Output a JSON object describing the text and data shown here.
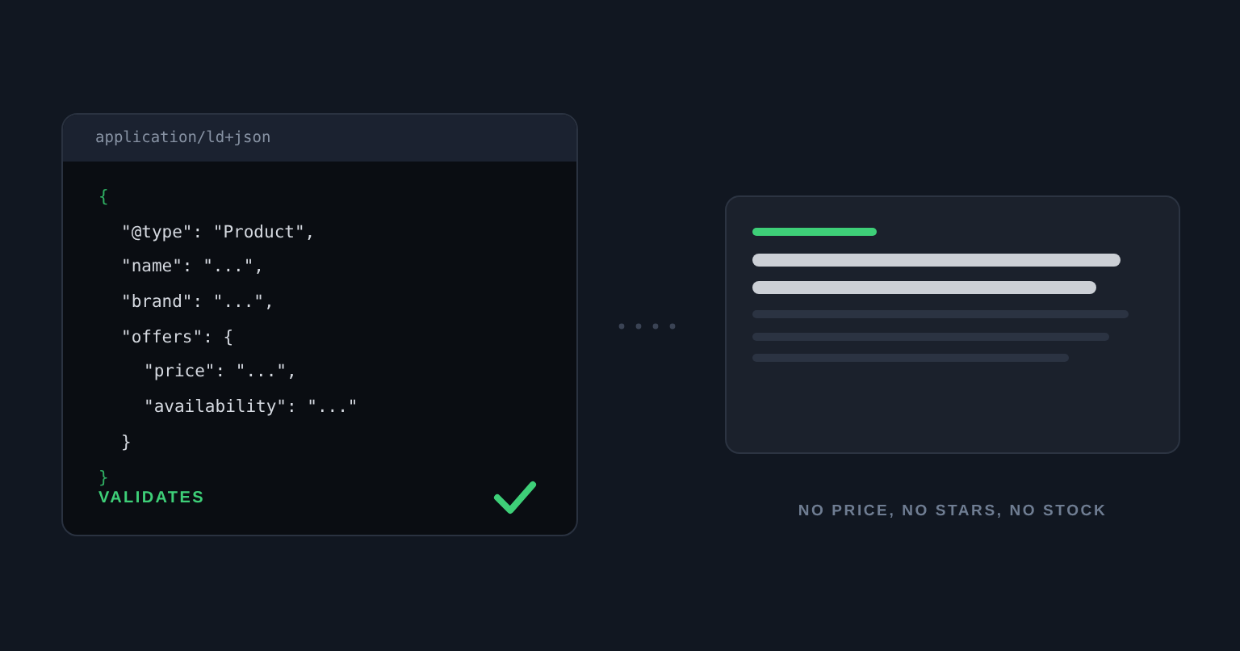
{
  "code_panel": {
    "title": "application/ld+json",
    "open": "{",
    "lines": [
      {
        "text": "\"@type\": \"Product\","
      },
      {
        "text": "\"name\": \"...\","
      },
      {
        "text": "\"brand\": \"...\","
      },
      {
        "text": "\"offers\": {",
        "children": [
          {
            "text": "\"price\": \"...\","
          },
          {
            "text": "\"availability\": \"...\""
          }
        ],
        "close": "}"
      }
    ],
    "close": "}",
    "status": "VALIDATES"
  },
  "preview": {
    "caption": "NO PRICE, NO STARS, NO STOCK"
  }
}
